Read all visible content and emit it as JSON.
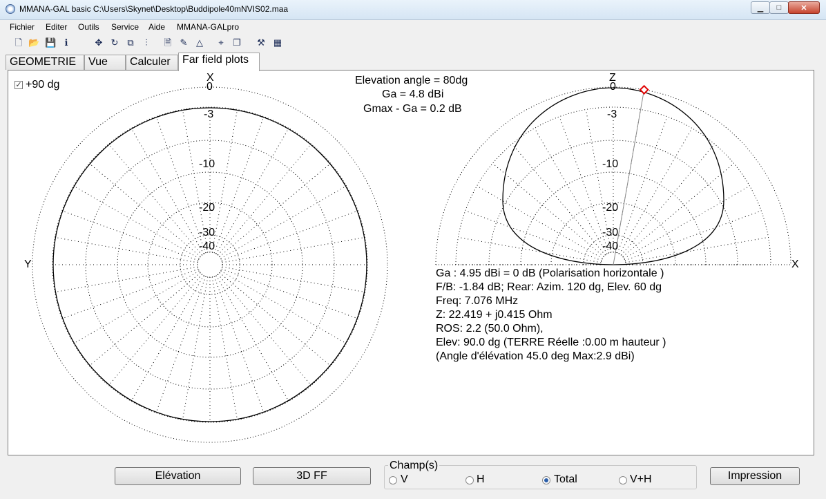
{
  "window": {
    "title": "MMANA-GAL basic C:\\Users\\Skynet\\Desktop\\Buddipole40mNVIS02.maa",
    "controls": {
      "minimize": "▁",
      "maximize": "□",
      "close": "✕"
    }
  },
  "menu": [
    "Fichier",
    "Editer",
    "Outils",
    "Service",
    "Aide",
    "MMANA-GALpro"
  ],
  "toolbar": {
    "icons": [
      "new-file-icon",
      "open-folder-icon",
      "save-icon",
      "info-icon",
      "move-icon",
      "rotate-icon",
      "copy-icon",
      "split-icon",
      "document-icon",
      "eraser-icon",
      "triangle-icon",
      "target-icon",
      "duplicate-icon",
      "tools-icon",
      "calculator-icon"
    ],
    "glyphs": [
      "🗋",
      "📂",
      "💾",
      "ℹ",
      "✥",
      "↻",
      "⧉",
      "⫶",
      "🗎",
      "✎",
      "△",
      "⌖",
      "❐",
      "⚒",
      "▦"
    ]
  },
  "tabs": [
    "GEOMETRIE",
    "Vue",
    "Calculer",
    "Far field plots"
  ],
  "active_tab": "Far field plots",
  "options": {
    "plus90_label": "+90 dg",
    "plus90_checked": true
  },
  "plot_header": {
    "elevation_angle": "Elevation angle =  80dg",
    "ga": "Ga = 4.8 dBi",
    "gmax_ga": "Gmax - Ga = 0.2 dB"
  },
  "azimuth_plot": {
    "axis_top": "X",
    "axis_left": "Y",
    "ring_labels": [
      "0",
      "-3",
      "-10",
      "-20",
      "-30",
      "-40"
    ]
  },
  "elevation_plot": {
    "axis_top": "Z",
    "axis_right": "X",
    "ring_labels": [
      "0",
      "-3",
      "-10",
      "-20",
      "-30",
      "-40"
    ],
    "marker_angle_deg": 80
  },
  "results": {
    "ga_line": "Ga : 4.95 dBi = 0 dB  (Polarisation horizontale )",
    "fb_line": "F/B: -1.84 dB; Rear: Azim. 120 dg, Elev. 60 dg",
    "freq_line": "Freq: 7.076 MHz",
    "z_line": "Z: 22.419 + j0.415 Ohm",
    "ros_line": "ROS: 2.2 (50.0 Ohm),",
    "elev_line": "Elev: 90.0 dg (TERRE Réelle    :0.00 m hauteur )",
    "angle_line": "(Angle d'élévation 45.0 deg Max:2.9 dBi)"
  },
  "buttons": {
    "elevation": "Elévation",
    "ff3d": "3D FF",
    "impression": "Impression"
  },
  "champs": {
    "title": "Champ(s)",
    "options": [
      "V",
      "H",
      "Total",
      "V+H"
    ],
    "selected": "Total"
  },
  "colors": {
    "pattern": "#000000",
    "grid": "#000000",
    "marker": "#e00000",
    "panel": "#ffffff"
  }
}
